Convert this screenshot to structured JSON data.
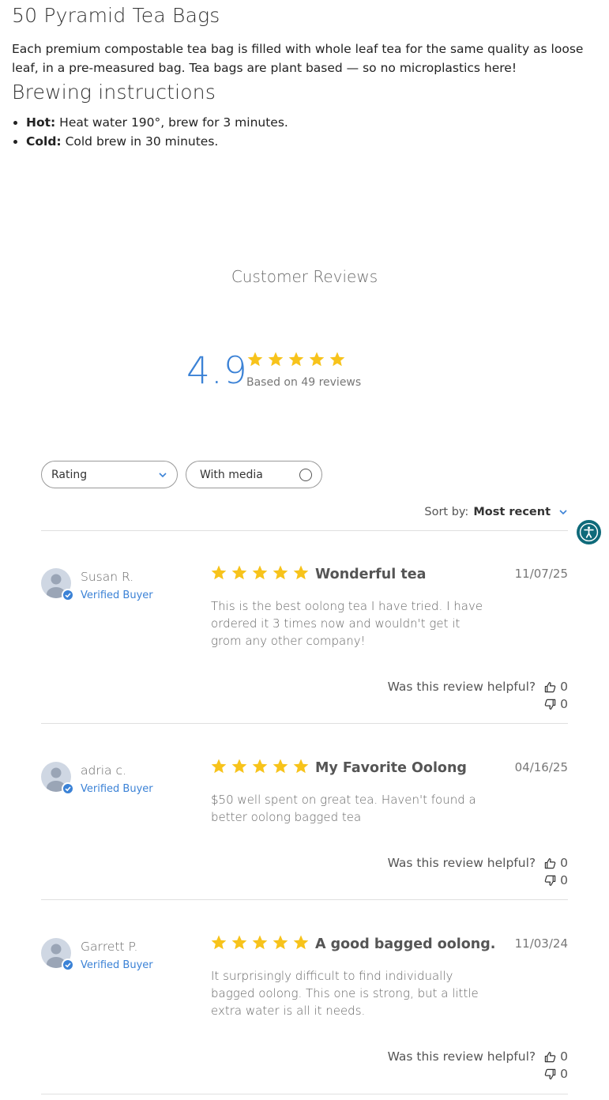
{
  "product": {
    "title": "50 Pyramid Tea Bags",
    "description": "Each premium compostable tea bag is filled with whole leaf tea for the same quality as loose leaf, in a pre-measured bag. Tea bags are plant based — so no microplastics here!",
    "brewing_heading": "Brewing instructions",
    "instructions": [
      {
        "label": "Hot:",
        "text": " Heat water 190°, brew for 3 minutes."
      },
      {
        "label": "Cold:",
        "text": " Cold brew in 30 minutes."
      }
    ]
  },
  "reviews_section": {
    "title": "Customer Reviews",
    "average": "4.9",
    "average_stars": 5,
    "based_on": "Based on 49 reviews"
  },
  "filters": {
    "rating_label": "Rating",
    "media_label": "With media"
  },
  "sort": {
    "label": "Sort by:",
    "value": "Most recent"
  },
  "colors": {
    "accent": "#3b82d6",
    "star": "#f7c31b",
    "accessibility_button": "#0f6a7a"
  },
  "icons": {
    "accessibility": "accessibility-icon",
    "thumbs_up": "thumbs-up-icon",
    "thumbs_down": "thumbs-down-icon",
    "verified": "check-badge-icon"
  },
  "reviews": [
    {
      "author": "Susan R.",
      "badge": "Verified Buyer",
      "stars": 5,
      "title": "Wonderful tea",
      "date": "11/07/25",
      "body": "This is the best oolong tea I have tried. I have ordered it 3 times now and wouldn't get it grom any other company!",
      "helpful_prompt": "Was this review helpful?",
      "up": "0",
      "down": "0"
    },
    {
      "author": "adria c.",
      "badge": "Verified Buyer",
      "stars": 5,
      "title": "My Favorite Oolong",
      "date": "04/16/25",
      "body": "$50 well spent on great tea. Haven't found a better oolong bagged tea",
      "helpful_prompt": "Was this review helpful?",
      "up": "0",
      "down": "0"
    },
    {
      "author": "Garrett P.",
      "badge": "Verified Buyer",
      "stars": 5,
      "title": "A good bagged oolong.",
      "date": "11/03/24",
      "body": "It surprisingly difficult to find individually bagged oolong. This one is strong, but a little extra water is all it needs.",
      "helpful_prompt": "Was this review helpful?",
      "up": "0",
      "down": "0"
    }
  ]
}
